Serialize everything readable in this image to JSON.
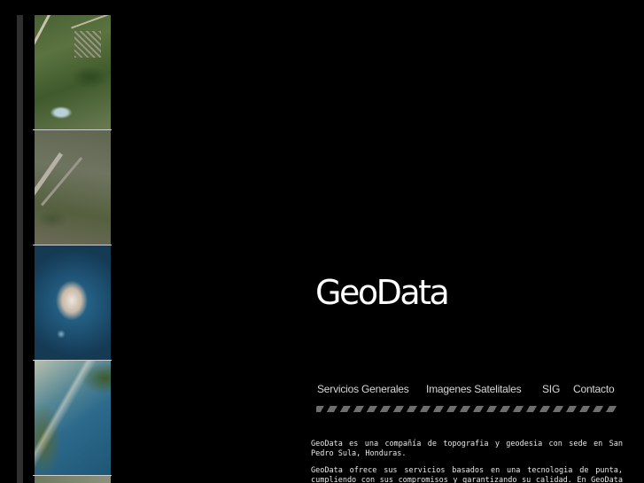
{
  "brand": {
    "name": "GeoData"
  },
  "gallery": {
    "images": [
      {
        "icon": "satellite-image-town"
      },
      {
        "icon": "satellite-image-airstrip"
      },
      {
        "icon": "satellite-image-island"
      },
      {
        "icon": "satellite-image-coast"
      },
      {
        "icon": "satellite-image-partial"
      }
    ]
  },
  "nav": {
    "items": [
      {
        "label": "Servicios Generales"
      },
      {
        "label": "Imagenes Satelitales"
      },
      {
        "label": "SIG"
      },
      {
        "label": "Contacto"
      }
    ]
  },
  "content": {
    "paragraphs": [
      "GeoData es una compañía de topografia y geodesia con sede en San Pedro Sula, Honduras.",
      "GeoData ofrece sus servicios basados en una tecnologia de punta, cumpliendo con sus compromisos y garantizando su calidad. En GeoData usted tiene un"
    ]
  },
  "colors": {
    "background": "#000000",
    "text": "#e8e8e8",
    "rail": "#2f2f2f",
    "divider": "#6e6e6e"
  }
}
